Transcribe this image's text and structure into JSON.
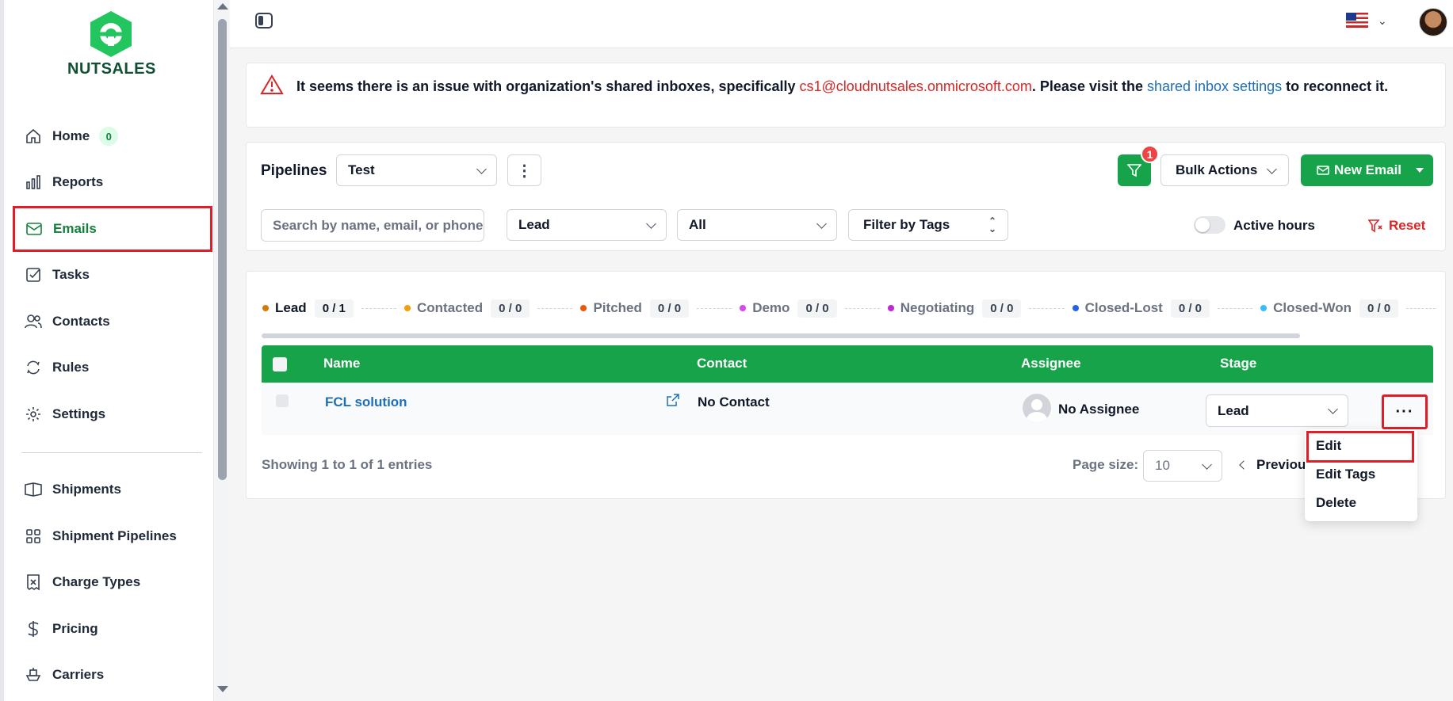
{
  "brand": {
    "name": "NUTSALES",
    "color": "#16a34a"
  },
  "sidebar": {
    "items": [
      {
        "label": "Home",
        "icon": "home-icon",
        "count": "0"
      },
      {
        "label": "Reports",
        "icon": "bar-chart-icon"
      },
      {
        "label": "Emails",
        "icon": "mail-icon",
        "active": true
      },
      {
        "label": "Tasks",
        "icon": "checkbox-icon"
      },
      {
        "label": "Contacts",
        "icon": "users-icon"
      },
      {
        "label": "Rules",
        "icon": "refresh-icon"
      },
      {
        "label": "Settings",
        "icon": "gear-icon"
      },
      {
        "label": "Shipments",
        "icon": "box-icon"
      },
      {
        "label": "Shipment Pipelines",
        "icon": "grid-icon"
      },
      {
        "label": "Charge Types",
        "icon": "receipt-icon"
      },
      {
        "label": "Pricing",
        "icon": "dollar-icon"
      },
      {
        "label": "Carriers",
        "icon": "ship-icon"
      }
    ]
  },
  "alert": {
    "prefix": "It seems there is an issue with organization's shared inboxes, specifically ",
    "email": "cs1@cloudnutsales.onmicrosoft.com",
    "middle": ". Please visit the ",
    "link": "shared inbox settings",
    "suffix": " to reconnect it."
  },
  "filters": {
    "pipelines_label": "Pipelines",
    "pipeline_value": "Test",
    "filter_badge_count": "1",
    "bulk_actions": "Bulk Actions",
    "new_email": "New Email",
    "search_placeholder": "Search by name, email, or phone",
    "stage_value": "Lead",
    "all_value": "All",
    "tags_value": "Filter by Tags",
    "active_hours": "Active hours",
    "reset": "Reset"
  },
  "stages": [
    {
      "name": "Lead",
      "count": "0 / 1",
      "color": "#d97706",
      "active": true
    },
    {
      "name": "Contacted",
      "count": "0 / 0",
      "color": "#f59e0b"
    },
    {
      "name": "Pitched",
      "count": "0 / 0",
      "color": "#ea580c"
    },
    {
      "name": "Demo",
      "count": "0 / 0",
      "color": "#d946ef"
    },
    {
      "name": "Negotiating",
      "count": "0 / 0",
      "color": "#c026d3"
    },
    {
      "name": "Closed-Lost",
      "count": "0 / 0",
      "color": "#2563eb"
    },
    {
      "name": "Closed-Won",
      "count": "0 / 0",
      "color": "#38bdf8"
    }
  ],
  "table": {
    "headers": {
      "name": "Name",
      "contact": "Contact",
      "assignee": "Assignee",
      "stage": "Stage"
    },
    "rows": [
      {
        "name": "FCL solution",
        "contact": "No Contact",
        "assignee": "No Assignee",
        "stage": "Lead"
      }
    ],
    "showing": "Showing 1 to 1 of 1 entries",
    "page_size_label": "Page size:",
    "page_size": "10",
    "previous": "Previous"
  },
  "row_menu": {
    "trigger": "···",
    "items": [
      "Edit",
      "Edit Tags",
      "Delete"
    ]
  }
}
